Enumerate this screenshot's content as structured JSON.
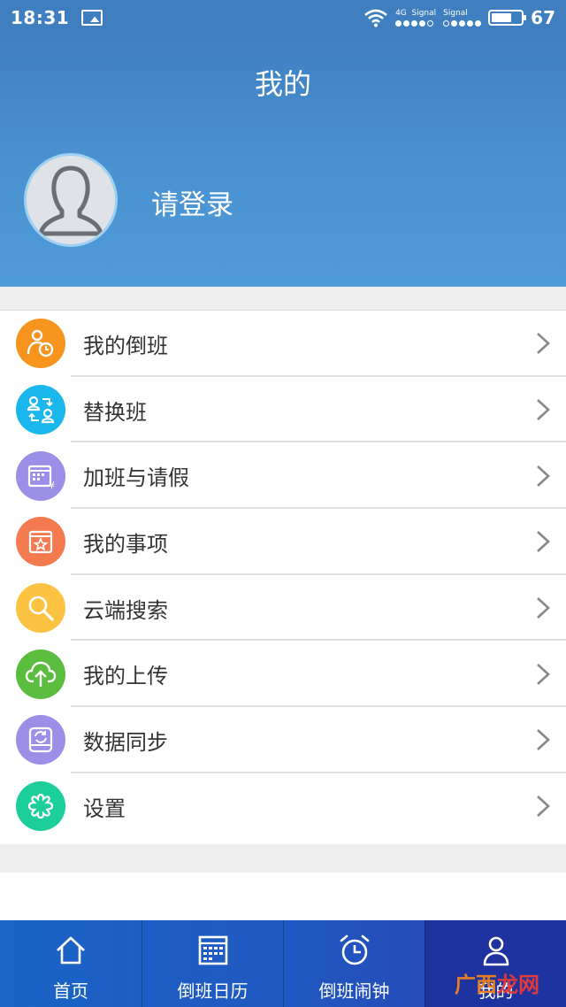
{
  "status_bar": {
    "time": "18:31",
    "network": "4G",
    "signal_label_1": "Signal",
    "signal_label_2": "Signal",
    "battery": "67"
  },
  "header": {
    "title": "我的",
    "login_text": "请登录"
  },
  "menu": [
    {
      "label": "我的倒班",
      "icon": "person-shift-icon",
      "color": "#f7941d"
    },
    {
      "label": "替换班",
      "icon": "swap-people-icon",
      "color": "#19b7ec"
    },
    {
      "label": "加班与请假",
      "icon": "calendar-yen-icon",
      "color": "#9b8fe8"
    },
    {
      "label": "我的事项",
      "icon": "calendar-star-icon",
      "color": "#f47b4f"
    },
    {
      "label": "云端搜索",
      "icon": "magnifier-icon",
      "color": "#fbc341"
    },
    {
      "label": "我的上传",
      "icon": "cloud-upload-icon",
      "color": "#5bbd3e"
    },
    {
      "label": "数据同步",
      "icon": "sync-drive-icon",
      "color": "#9b8fe8"
    },
    {
      "label": "设置",
      "icon": "gear-flower-icon",
      "color": "#1ccf9a"
    }
  ],
  "tabs": [
    {
      "label": "首页",
      "icon": "home-icon"
    },
    {
      "label": "倒班日历",
      "icon": "calendar-icon"
    },
    {
      "label": "倒班闹钟",
      "icon": "alarm-clock-icon"
    },
    {
      "label": "我的",
      "icon": "person-icon",
      "active": true
    }
  ],
  "watermark": {
    "part1": "广西",
    "part2": "龙网"
  },
  "colors": {
    "header_top": "#3f80c2",
    "tabbar": "#1a64c6",
    "tab_active": "#1e33a0"
  }
}
